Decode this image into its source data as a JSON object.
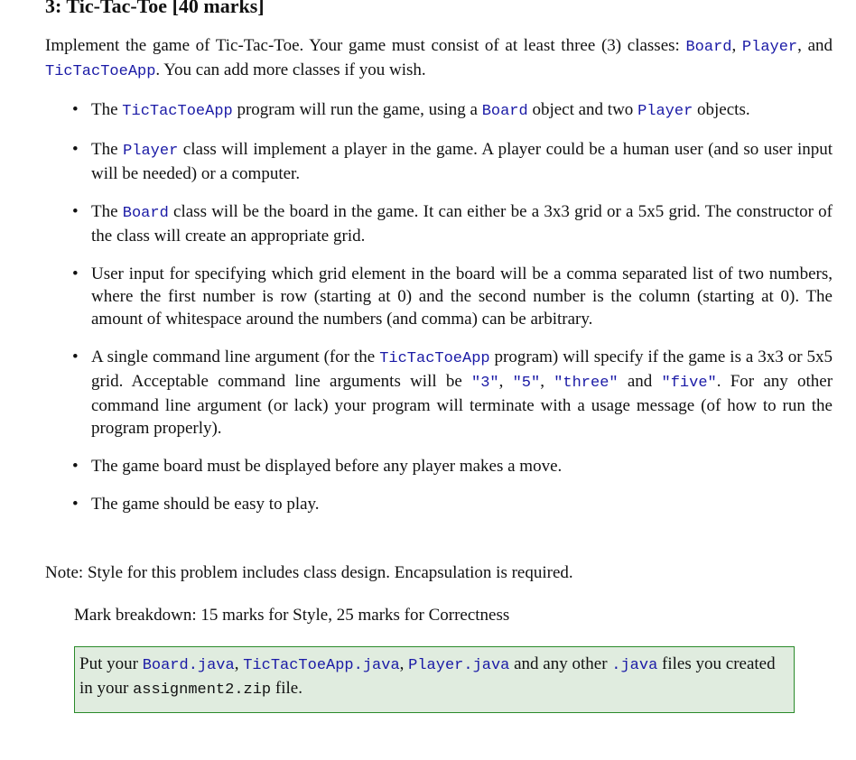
{
  "title": "3:  Tic-Tac-Toe [40 marks]",
  "intro": {
    "t1": "Implement the game of Tic-Tac-Toe. Your game must consist of at least three (3) classes: ",
    "c1": "Board",
    "t2": ", ",
    "c2": "Player",
    "t3": ", and ",
    "c3": "TicTacToeApp",
    "t4": ". You can add more classes if you wish."
  },
  "bullets": [
    {
      "t1": "The ",
      "c1": "TicTacToeApp",
      "t2": " program will run the game, using a ",
      "c2": "Board",
      "t3": " object and two ",
      "c3": "Player",
      "t4": " objects."
    },
    {
      "t1": "The ",
      "c1": "Player",
      "t2": " class will implement a player in the game. A player could be a human user (and so user input will be needed) or a computer."
    },
    {
      "t1": "The ",
      "c1": "Board",
      "t2": " class will be the board in the game. It can either be a 3x3 grid or a 5x5 grid. The constructor of the class will create an appropriate grid."
    },
    {
      "t1": "User input for specifying which grid element in the board will be a comma separated list of two numbers, where the first number is row (starting at 0) and the second number is the column (starting at 0). The amount of whitespace around the numbers (and comma) can be arbitrary."
    },
    {
      "t1": "A single command line argument (for the ",
      "c1": "TicTacToeApp",
      "t2": " program) will specify if the game is a 3x3 or 5x5 grid.  Acceptable command line arguments will be ",
      "c2": "\"3\"",
      "t3": ", ",
      "c3": "\"5\"",
      "t4": ", ",
      "c4": "\"three\"",
      "t5": " and ",
      "c5": "\"five\"",
      "t6": ". For any other command line argument (or lack) your program will terminate with a usage message (of how to run the program properly)."
    },
    {
      "t1": "The game board must be displayed before any player makes a move."
    },
    {
      "t1": "The game should be easy to play."
    }
  ],
  "bullet_glyph": "•",
  "note": "Note: Style for this problem includes class design. Encapsulation is required.",
  "mark_breakdown": "Mark breakdown: 15 marks for Style, 25 marks for Correctness",
  "box": {
    "t1": "Put your ",
    "c1": "Board.java",
    "t2": ", ",
    "c2": "TicTacToeApp.java",
    "t3": ", ",
    "c3": "Player.java",
    "t4": " and any other ",
    "c4": ".java",
    "t5": " files you created in your ",
    "c5": "assignment2.zip",
    "t6": " file."
  }
}
